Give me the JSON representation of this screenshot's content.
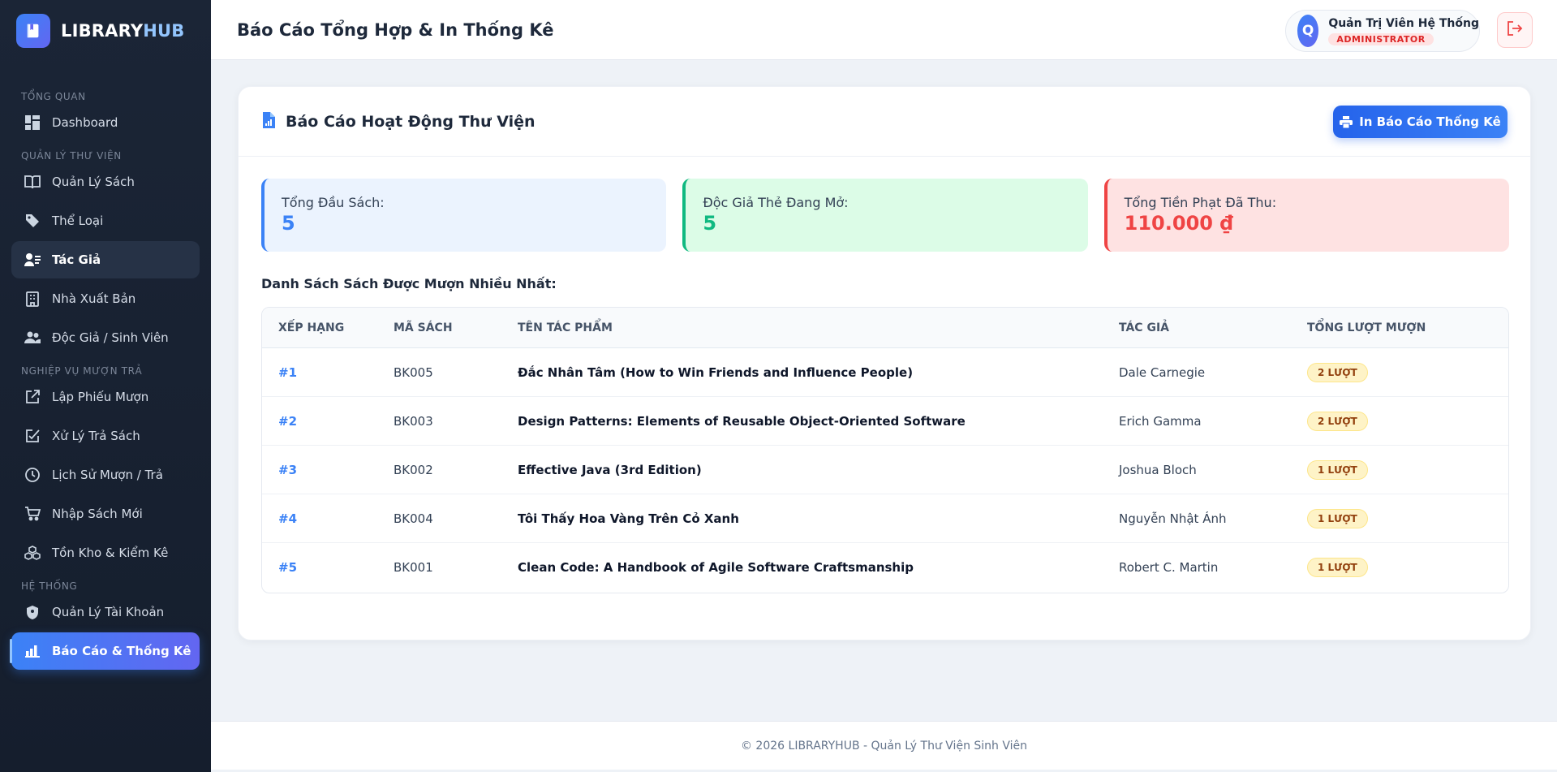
{
  "brand": {
    "name_main": "LIBRARY",
    "name_accent": "HUB"
  },
  "sidebar": {
    "sections": [
      {
        "title": "Tổng Quan",
        "items": [
          {
            "label": "Dashboard",
            "icon": "dashboard-icon"
          }
        ]
      },
      {
        "title": "Quản Lý Thư Viện",
        "items": [
          {
            "label": "Quản Lý Sách",
            "icon": "book-open-icon"
          },
          {
            "label": "Thể Loại",
            "icon": "tag-icon"
          },
          {
            "label": "Tác Giả",
            "icon": "user-list-icon"
          },
          {
            "label": "Nhà Xuất Bản",
            "icon": "building-icon"
          },
          {
            "label": "Độc Giả / Sinh Viên",
            "icon": "users-icon"
          }
        ]
      },
      {
        "title": "Nghiệp Vụ Mượn Trả",
        "items": [
          {
            "label": "Lập Phiếu Mượn",
            "icon": "external-link-icon"
          },
          {
            "label": "Xử Lý Trả Sách",
            "icon": "checkbox-edit-icon"
          },
          {
            "label": "Lịch Sử Mượn / Trả",
            "icon": "clock-icon"
          },
          {
            "label": "Nhập Sách Mới",
            "icon": "cart-icon"
          },
          {
            "label": "Tồn Kho & Kiểm Kê",
            "icon": "cubes-icon"
          }
        ]
      },
      {
        "title": "Hệ Thống",
        "items": [
          {
            "label": "Quản Lý Tài Khoản",
            "icon": "shield-icon"
          },
          {
            "label": "Báo Cáo & Thống Kê",
            "icon": "bar-chart-icon"
          }
        ]
      }
    ]
  },
  "header": {
    "title": "Báo Cáo Tổng Hợp & In Thống Kê",
    "user": {
      "initial": "Q",
      "name": "Quản Trị Viên Hệ Thống",
      "role": "ADMINISTRATOR"
    }
  },
  "report": {
    "title": "Báo Cáo Hoạt Động Thư Viện",
    "print_label": "In Báo Cáo Thống Kê",
    "stats": {
      "books": {
        "label": "Tổng Đầu Sách:",
        "value": "5"
      },
      "readers": {
        "label": "Độc Giả Thẻ Đang Mở:",
        "value": "5"
      },
      "fines": {
        "label": "Tổng Tiền Phạt Đã Thu:",
        "value": "110.000 ₫"
      }
    },
    "list_title": "Danh Sách Sách Được Mượn Nhiều Nhất:",
    "columns": [
      "Xếp Hạng",
      "Mã Sách",
      "Tên Tác Phẩm",
      "Tác Giả",
      "Tổng Lượt Mượn"
    ],
    "rows": [
      {
        "rank": "#1",
        "code": "BK005",
        "title": "Đắc Nhân Tâm (How to Win Friends and Influence People)",
        "author": "Dale Carnegie",
        "count": "2 LƯỢT"
      },
      {
        "rank": "#2",
        "code": "BK003",
        "title": "Design Patterns: Elements of Reusable Object-Oriented Software",
        "author": "Erich Gamma",
        "count": "2 LƯỢT"
      },
      {
        "rank": "#3",
        "code": "BK002",
        "title": "Effective Java (3rd Edition)",
        "author": "Joshua Bloch",
        "count": "1 LƯỢT"
      },
      {
        "rank": "#4",
        "code": "BK004",
        "title": "Tôi Thấy Hoa Vàng Trên Cỏ Xanh",
        "author": "Nguyễn Nhật Ánh",
        "count": "1 LƯỢT"
      },
      {
        "rank": "#5",
        "code": "BK001",
        "title": "Clean Code: A Handbook of Agile Software Craftsmanship",
        "author": "Robert C. Martin",
        "count": "1 LƯỢT"
      }
    ]
  },
  "footer": {
    "text": "© 2026 LIBRARYHUB - Quản Lý Thư Viện Sinh Viên"
  },
  "colors": {
    "primary": "#3b82f6",
    "sidebar_bg": "#1b2536",
    "success": "#10b981",
    "danger": "#ef4444",
    "warning_bg": "#fef3c7"
  }
}
